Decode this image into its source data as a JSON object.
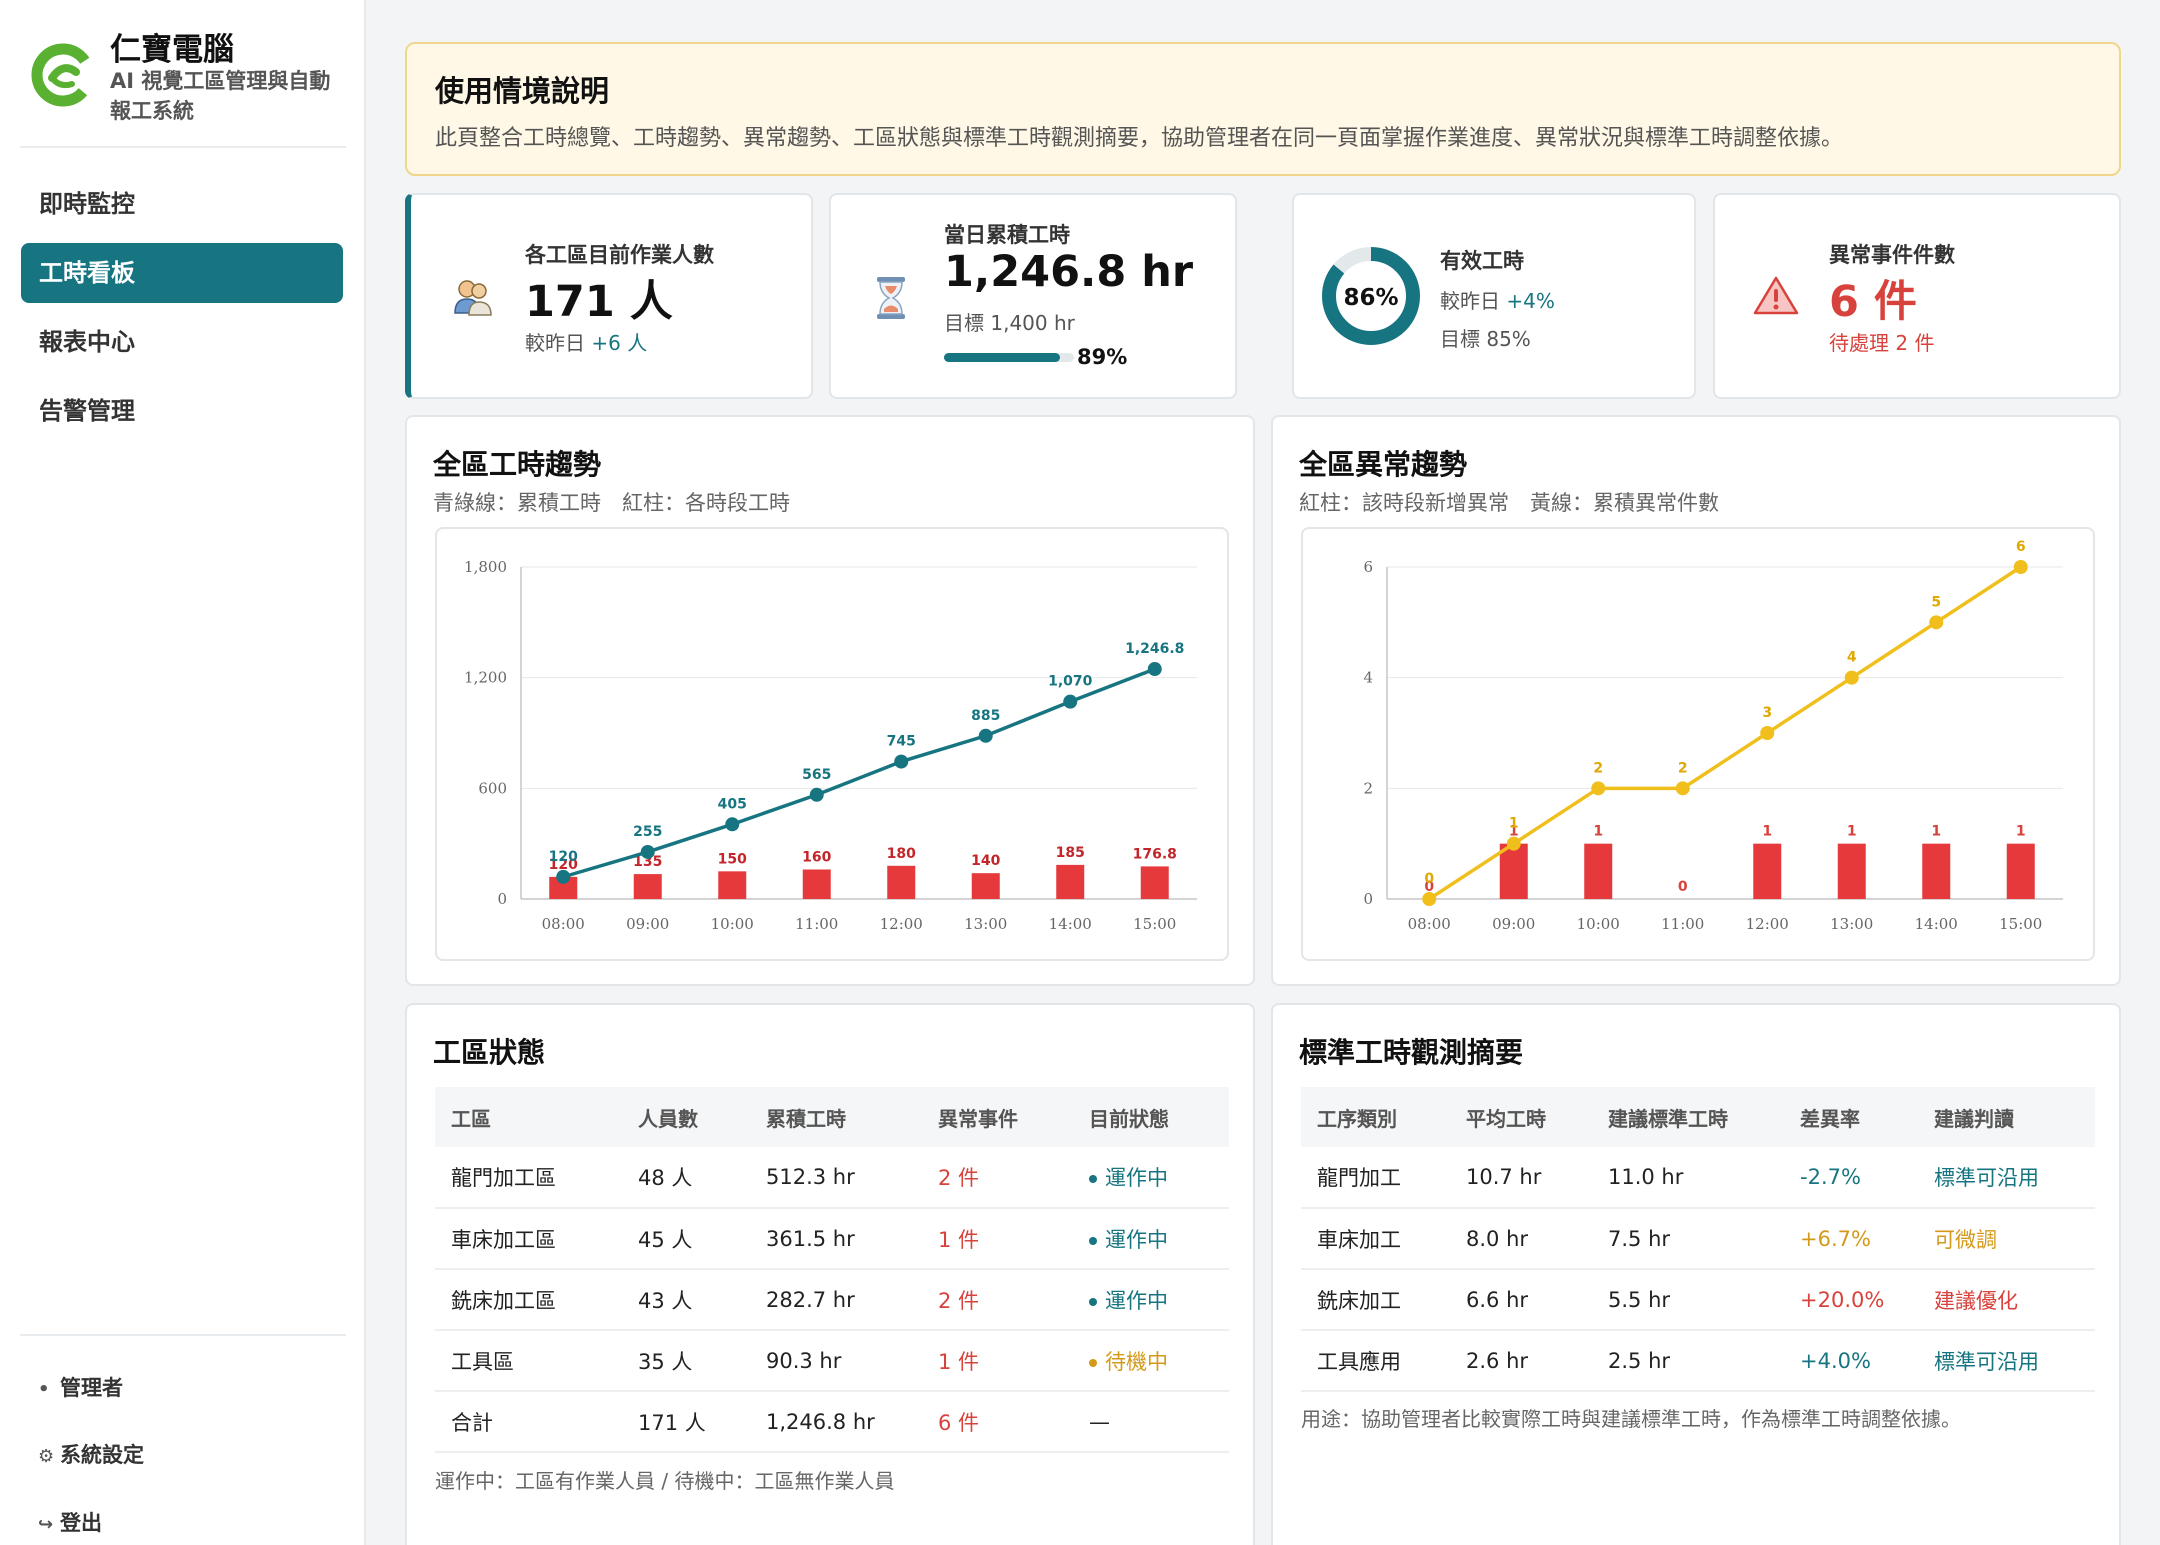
{
  "brand": {
    "name": "仁寶電腦",
    "subtitle": "AI 視覺工區管理與自動報工系統",
    "colors": {
      "accent": "#177581",
      "logo_green": "#5ab031"
    }
  },
  "nav": {
    "items": [
      {
        "label": "即時監控"
      },
      {
        "label": "工時看板",
        "active": true
      },
      {
        "label": "報表中心"
      },
      {
        "label": "告警管理"
      }
    ]
  },
  "sidebar_footer": {
    "user": "管理者",
    "settings": "系統設定",
    "logout": "登出"
  },
  "notice": {
    "title": "使用情境說明",
    "text": "此頁整合工時總覽、工時趨勢、異常趨勢、工區狀態與標準工時觀測摘要，協助管理者在同一頁面掌握作業進度、異常狀況與標準工時調整依據。"
  },
  "kpis": {
    "workers": {
      "label": "各工區目前作業人數",
      "value": "171 人",
      "compare_prefix": "較昨日",
      "compare_value": "+6 人",
      "icon": "workers-icon"
    },
    "hours": {
      "label": "當日累積工時",
      "value": "1,246.8 hr",
      "target": "目標 1,400 hr",
      "progress_label": "89%",
      "progress": 0.89,
      "icon": "hourglass-icon"
    },
    "effective": {
      "label": "有效工時",
      "ring_label": "86%",
      "ring_value": 0.86,
      "compare_prefix": "較昨日",
      "compare_value": "+4%",
      "target": "目標 85%"
    },
    "anomalies": {
      "label": "異常事件件數",
      "value": "6 件",
      "pending": "待處理 2 件",
      "icon": "warning-icon"
    }
  },
  "hours_panel": {
    "title": "全區工時趨勢",
    "subtitle": "青綠線：累積工時　紅柱：各時段工時"
  },
  "anomaly_panel": {
    "title": "全區異常趨勢",
    "subtitle": "紅柱：該時段新增異常　黃線：累積異常件數"
  },
  "chart_data": [
    {
      "type": "bar",
      "categories": [
        "08:00",
        "09:00",
        "10:00",
        "11:00",
        "12:00",
        "13:00",
        "14:00",
        "15:00"
      ],
      "series": [
        {
          "values": [
            120,
            135,
            150,
            160,
            180,
            140,
            185,
            176.8
          ],
          "color": "#e5393b",
          "kind": "bar",
          "labels": [
            "120",
            "135",
            "150",
            "160",
            "180",
            "140",
            "185",
            "176.8"
          ]
        },
        {
          "values": [
            120,
            255,
            405,
            565,
            745,
            885,
            1070,
            1246.8
          ],
          "color": "#177581",
          "kind": "line",
          "labels": [
            "120",
            "255",
            "405",
            "565",
            "745",
            "885",
            "1,070",
            "1,246.8"
          ]
        }
      ],
      "yticks": [
        "0",
        "600",
        "1,200",
        "1,800"
      ],
      "ylim": [
        0,
        1800
      ],
      "grid": true
    },
    {
      "type": "bar",
      "categories": [
        "08:00",
        "09:00",
        "10:00",
        "11:00",
        "12:00",
        "13:00",
        "14:00",
        "15:00"
      ],
      "series": [
        {
          "values": [
            0,
            1,
            1,
            0,
            1,
            1,
            1,
            1
          ],
          "color": "#e5393b",
          "kind": "bar",
          "labels": [
            "0",
            "1",
            "1",
            "0",
            "1",
            "1",
            "1",
            "1"
          ]
        },
        {
          "values": [
            0,
            1,
            2,
            2,
            3,
            4,
            5,
            6
          ],
          "color": "#f0bf1c",
          "kind": "line",
          "labels": [
            "0",
            "1",
            "2",
            "2",
            "3",
            "4",
            "5",
            "6"
          ]
        }
      ],
      "yticks": [
        "0",
        "2",
        "4",
        "6"
      ],
      "ylim": [
        0,
        6
      ],
      "grid": true
    }
  ],
  "zone_status": {
    "title": "工區狀態",
    "headers": [
      "工區",
      "人員數",
      "累積工時",
      "異常事件",
      "目前狀態"
    ],
    "rows": [
      {
        "zone": "龍門加工區",
        "people": "48 人",
        "hours": "512.3 hr",
        "events": "2 件",
        "status": "運作中",
        "status_type": "running"
      },
      {
        "zone": "車床加工區",
        "people": "45 人",
        "hours": "361.5 hr",
        "events": "1 件",
        "status": "運作中",
        "status_type": "running"
      },
      {
        "zone": "銑床加工區",
        "people": "43 人",
        "hours": "282.7 hr",
        "events": "2 件",
        "status": "運作中",
        "status_type": "running"
      },
      {
        "zone": "工具區",
        "people": "35 人",
        "hours": "90.3 hr",
        "events": "1 件",
        "status": "待機中",
        "status_type": "idle"
      },
      {
        "zone": "合計",
        "people": "171 人",
        "hours": "1,246.8 hr",
        "events": "6 件",
        "status": "—",
        "status_type": "none"
      }
    ],
    "note": "運作中：工區有作業人員 / 待機中：工區無作業人員"
  },
  "std_hours": {
    "title": "標準工時觀測摘要",
    "headers": [
      "工序類別",
      "平均工時",
      "建議標準工時",
      "差異率",
      "建議判讀"
    ],
    "rows": [
      {
        "process": "龍門加工",
        "avg": "10.7 hr",
        "std": "11.0 hr",
        "diff": "-2.7%",
        "verdict": "標準可沿用",
        "tone": "teal"
      },
      {
        "process": "車床加工",
        "avg": "8.0 hr",
        "std": "7.5 hr",
        "diff": "+6.7%",
        "verdict": "可微調",
        "tone": "amber"
      },
      {
        "process": "銑床加工",
        "avg": "6.6 hr",
        "std": "5.5 hr",
        "diff": "+20.0%",
        "verdict": "建議優化",
        "tone": "red"
      },
      {
        "process": "工具應用",
        "avg": "2.6 hr",
        "std": "2.5 hr",
        "diff": "+4.0%",
        "verdict": "標準可沿用",
        "tone": "teal"
      }
    ],
    "note": "用途：協助管理者比較實際工時與建議標準工時，作為標準工時調整依據。"
  }
}
